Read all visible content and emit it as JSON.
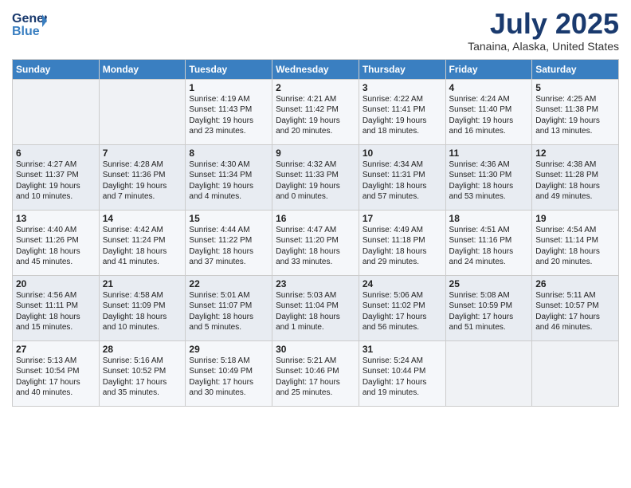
{
  "header": {
    "logo_line1": "General",
    "logo_line2": "Blue",
    "month": "July 2025",
    "location": "Tanaina, Alaska, United States"
  },
  "days_of_week": [
    "Sunday",
    "Monday",
    "Tuesday",
    "Wednesday",
    "Thursday",
    "Friday",
    "Saturday"
  ],
  "weeks": [
    [
      {
        "day": "",
        "sunrise": "",
        "sunset": "",
        "daylight": ""
      },
      {
        "day": "",
        "sunrise": "",
        "sunset": "",
        "daylight": ""
      },
      {
        "day": "1",
        "sunrise": "Sunrise: 4:19 AM",
        "sunset": "Sunset: 11:43 PM",
        "daylight": "Daylight: 19 hours and 23 minutes."
      },
      {
        "day": "2",
        "sunrise": "Sunrise: 4:21 AM",
        "sunset": "Sunset: 11:42 PM",
        "daylight": "Daylight: 19 hours and 20 minutes."
      },
      {
        "day": "3",
        "sunrise": "Sunrise: 4:22 AM",
        "sunset": "Sunset: 11:41 PM",
        "daylight": "Daylight: 19 hours and 18 minutes."
      },
      {
        "day": "4",
        "sunrise": "Sunrise: 4:24 AM",
        "sunset": "Sunset: 11:40 PM",
        "daylight": "Daylight: 19 hours and 16 minutes."
      },
      {
        "day": "5",
        "sunrise": "Sunrise: 4:25 AM",
        "sunset": "Sunset: 11:38 PM",
        "daylight": "Daylight: 19 hours and 13 minutes."
      }
    ],
    [
      {
        "day": "6",
        "sunrise": "Sunrise: 4:27 AM",
        "sunset": "Sunset: 11:37 PM",
        "daylight": "Daylight: 19 hours and 10 minutes."
      },
      {
        "day": "7",
        "sunrise": "Sunrise: 4:28 AM",
        "sunset": "Sunset: 11:36 PM",
        "daylight": "Daylight: 19 hours and 7 minutes."
      },
      {
        "day": "8",
        "sunrise": "Sunrise: 4:30 AM",
        "sunset": "Sunset: 11:34 PM",
        "daylight": "Daylight: 19 hours and 4 minutes."
      },
      {
        "day": "9",
        "sunrise": "Sunrise: 4:32 AM",
        "sunset": "Sunset: 11:33 PM",
        "daylight": "Daylight: 19 hours and 0 minutes."
      },
      {
        "day": "10",
        "sunrise": "Sunrise: 4:34 AM",
        "sunset": "Sunset: 11:31 PM",
        "daylight": "Daylight: 18 hours and 57 minutes."
      },
      {
        "day": "11",
        "sunrise": "Sunrise: 4:36 AM",
        "sunset": "Sunset: 11:30 PM",
        "daylight": "Daylight: 18 hours and 53 minutes."
      },
      {
        "day": "12",
        "sunrise": "Sunrise: 4:38 AM",
        "sunset": "Sunset: 11:28 PM",
        "daylight": "Daylight: 18 hours and 49 minutes."
      }
    ],
    [
      {
        "day": "13",
        "sunrise": "Sunrise: 4:40 AM",
        "sunset": "Sunset: 11:26 PM",
        "daylight": "Daylight: 18 hours and 45 minutes."
      },
      {
        "day": "14",
        "sunrise": "Sunrise: 4:42 AM",
        "sunset": "Sunset: 11:24 PM",
        "daylight": "Daylight: 18 hours and 41 minutes."
      },
      {
        "day": "15",
        "sunrise": "Sunrise: 4:44 AM",
        "sunset": "Sunset: 11:22 PM",
        "daylight": "Daylight: 18 hours and 37 minutes."
      },
      {
        "day": "16",
        "sunrise": "Sunrise: 4:47 AM",
        "sunset": "Sunset: 11:20 PM",
        "daylight": "Daylight: 18 hours and 33 minutes."
      },
      {
        "day": "17",
        "sunrise": "Sunrise: 4:49 AM",
        "sunset": "Sunset: 11:18 PM",
        "daylight": "Daylight: 18 hours and 29 minutes."
      },
      {
        "day": "18",
        "sunrise": "Sunrise: 4:51 AM",
        "sunset": "Sunset: 11:16 PM",
        "daylight": "Daylight: 18 hours and 24 minutes."
      },
      {
        "day": "19",
        "sunrise": "Sunrise: 4:54 AM",
        "sunset": "Sunset: 11:14 PM",
        "daylight": "Daylight: 18 hours and 20 minutes."
      }
    ],
    [
      {
        "day": "20",
        "sunrise": "Sunrise: 4:56 AM",
        "sunset": "Sunset: 11:11 PM",
        "daylight": "Daylight: 18 hours and 15 minutes."
      },
      {
        "day": "21",
        "sunrise": "Sunrise: 4:58 AM",
        "sunset": "Sunset: 11:09 PM",
        "daylight": "Daylight: 18 hours and 10 minutes."
      },
      {
        "day": "22",
        "sunrise": "Sunrise: 5:01 AM",
        "sunset": "Sunset: 11:07 PM",
        "daylight": "Daylight: 18 hours and 5 minutes."
      },
      {
        "day": "23",
        "sunrise": "Sunrise: 5:03 AM",
        "sunset": "Sunset: 11:04 PM",
        "daylight": "Daylight: 18 hours and 1 minute."
      },
      {
        "day": "24",
        "sunrise": "Sunrise: 5:06 AM",
        "sunset": "Sunset: 11:02 PM",
        "daylight": "Daylight: 17 hours and 56 minutes."
      },
      {
        "day": "25",
        "sunrise": "Sunrise: 5:08 AM",
        "sunset": "Sunset: 10:59 PM",
        "daylight": "Daylight: 17 hours and 51 minutes."
      },
      {
        "day": "26",
        "sunrise": "Sunrise: 5:11 AM",
        "sunset": "Sunset: 10:57 PM",
        "daylight": "Daylight: 17 hours and 46 minutes."
      }
    ],
    [
      {
        "day": "27",
        "sunrise": "Sunrise: 5:13 AM",
        "sunset": "Sunset: 10:54 PM",
        "daylight": "Daylight: 17 hours and 40 minutes."
      },
      {
        "day": "28",
        "sunrise": "Sunrise: 5:16 AM",
        "sunset": "Sunset: 10:52 PM",
        "daylight": "Daylight: 17 hours and 35 minutes."
      },
      {
        "day": "29",
        "sunrise": "Sunrise: 5:18 AM",
        "sunset": "Sunset: 10:49 PM",
        "daylight": "Daylight: 17 hours and 30 minutes."
      },
      {
        "day": "30",
        "sunrise": "Sunrise: 5:21 AM",
        "sunset": "Sunset: 10:46 PM",
        "daylight": "Daylight: 17 hours and 25 minutes."
      },
      {
        "day": "31",
        "sunrise": "Sunrise: 5:24 AM",
        "sunset": "Sunset: 10:44 PM",
        "daylight": "Daylight: 17 hours and 19 minutes."
      },
      {
        "day": "",
        "sunrise": "",
        "sunset": "",
        "daylight": ""
      },
      {
        "day": "",
        "sunrise": "",
        "sunset": "",
        "daylight": ""
      }
    ]
  ]
}
